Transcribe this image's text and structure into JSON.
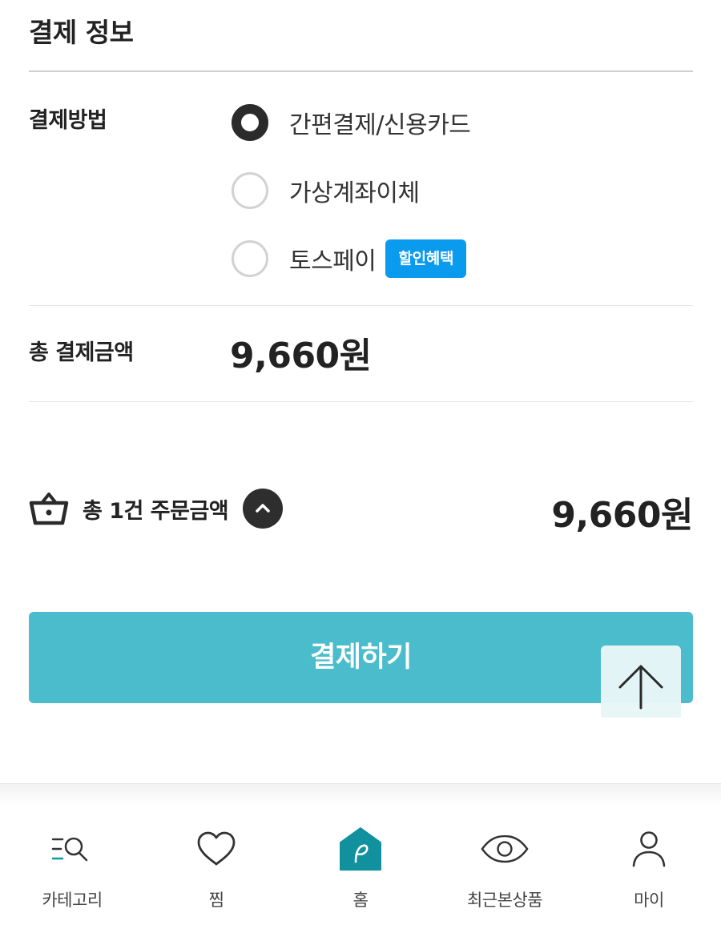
{
  "payment_info": {
    "title": "결제 정보",
    "method_label": "결제방법",
    "methods": [
      {
        "label": "간편결제/신용카드",
        "selected": true
      },
      {
        "label": "가상계좌이체",
        "selected": false
      },
      {
        "label": "토스페이",
        "selected": false,
        "badge": "할인혜택"
      }
    ],
    "total_label": "총 결제금액",
    "total_amount": "9,660원"
  },
  "order_summary": {
    "label": "총 1건 주문금액",
    "amount": "9,660원"
  },
  "pay_button": {
    "label": "결제하기"
  },
  "bottom_nav": {
    "items": [
      {
        "label": "카테고리",
        "icon": "category-search-icon"
      },
      {
        "label": "찜",
        "icon": "heart-icon"
      },
      {
        "label": "홈",
        "icon": "home-icon",
        "active": true
      },
      {
        "label": "최근본상품",
        "icon": "eye-icon"
      },
      {
        "label": "마이",
        "icon": "person-icon"
      }
    ]
  },
  "colors": {
    "accent": "#4bbccc",
    "badge": "#0a9bef",
    "home_icon": "#11909e",
    "text": "#222222"
  }
}
